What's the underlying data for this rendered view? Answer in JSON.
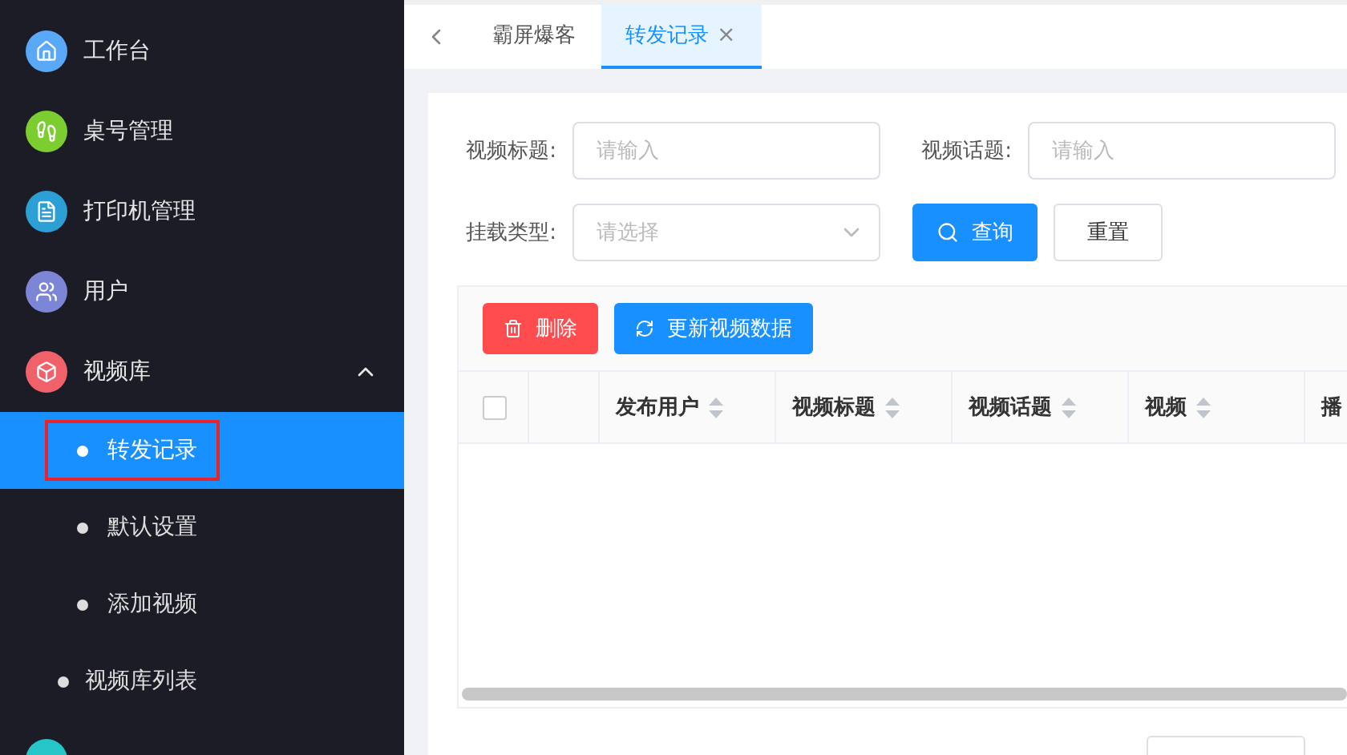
{
  "sidebar": {
    "items": [
      {
        "label": "工作台",
        "kind": "group",
        "color": "#5aa9f8"
      },
      {
        "label": "桌号管理",
        "kind": "group",
        "color": "#7ccd2f"
      },
      {
        "label": "打印机管理",
        "kind": "group",
        "color": "#2c9fd4"
      },
      {
        "label": "用户",
        "kind": "group",
        "color": "#7c85d6"
      },
      {
        "label": "视频库",
        "kind": "group",
        "color": "#f0616a",
        "expanded": true,
        "children": [
          {
            "label": "转发记录",
            "selected": true,
            "annotated": true
          },
          {
            "label": "默认设置",
            "selected": false,
            "annotated": false
          },
          {
            "label": "添加视频",
            "selected": false,
            "annotated": false
          }
        ]
      },
      {
        "label": "视频库列表",
        "kind": "link"
      }
    ]
  },
  "tabs": [
    {
      "label": "霸屏爆客",
      "selected": false
    },
    {
      "label": "转发记录",
      "selected": true,
      "close": "×"
    }
  ],
  "filters": [
    {
      "label": "视频标题:",
      "placeholder": "请输入",
      "kind": "input"
    },
    {
      "label": "视频话题:",
      "placeholder": "请输入",
      "kind": "input"
    },
    {
      "label": "挂载类型:",
      "placeholder": "请选择",
      "kind": "select"
    }
  ],
  "search_button": "查询",
  "reset_button": "重置",
  "toolbar": [
    {
      "label": "删除",
      "kind": "danger"
    },
    {
      "label": "更新视频数据",
      "kind": "primary"
    }
  ],
  "table": {
    "select_all_checked": false,
    "columns": [
      {
        "label": "发布用户"
      },
      {
        "label": "视频标题"
      },
      {
        "label": "视频话题"
      },
      {
        "label": "视频"
      },
      {
        "label": "播"
      }
    ]
  }
}
